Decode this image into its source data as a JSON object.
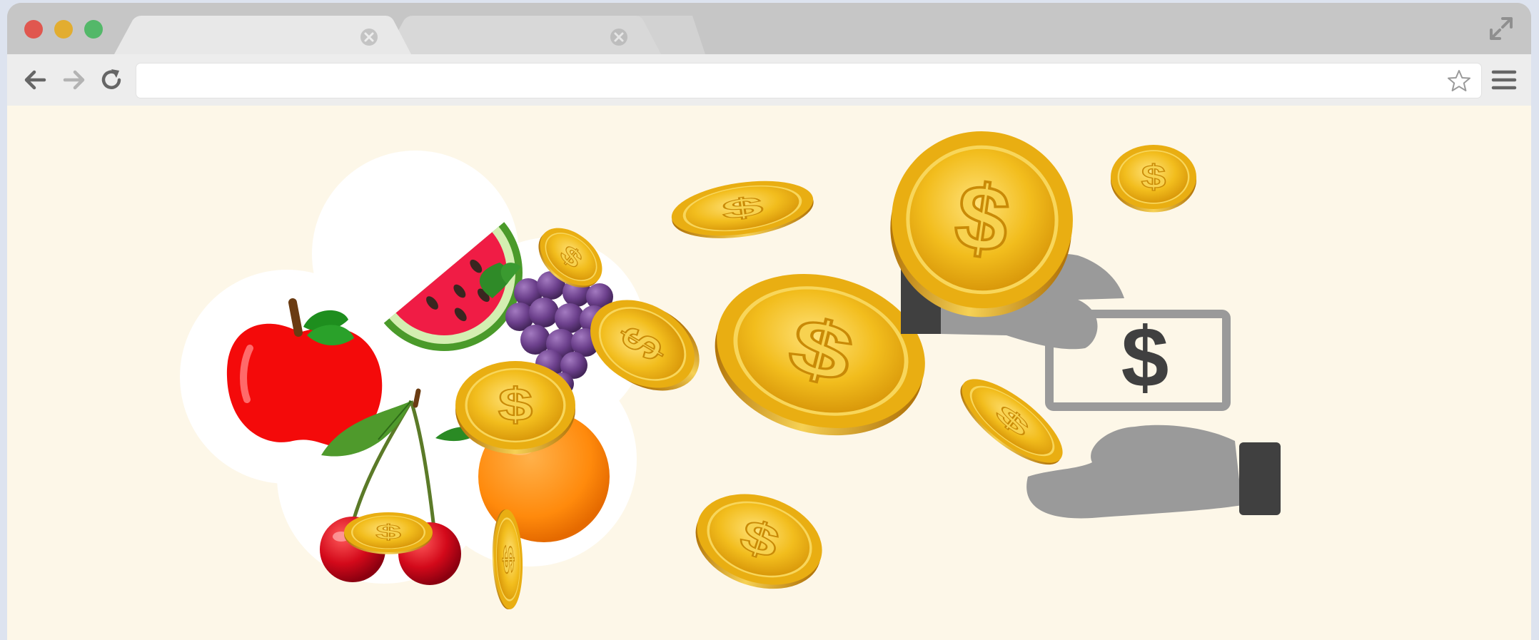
{
  "browser": {
    "tabs": [
      {
        "label": "",
        "active": true
      },
      {
        "label": "",
        "active": false
      }
    ],
    "address_bar": {
      "value": "",
      "placeholder": ""
    },
    "icons": {
      "back": "back-arrow-icon",
      "forward": "forward-arrow-icon",
      "reload": "reload-icon",
      "bookmark": "star-icon",
      "menu": "hamburger-menu-icon",
      "fullscreen": "expand-icon",
      "tab_close": "close-icon"
    }
  },
  "illustration": {
    "banknote_symbol": "$",
    "coin_symbol": "$",
    "colors": {
      "background": "#fdf7e8",
      "coin_gold": "#f2bd1d",
      "hand_gray": "#9a9a9a",
      "cuff_dark": "#404040"
    }
  }
}
